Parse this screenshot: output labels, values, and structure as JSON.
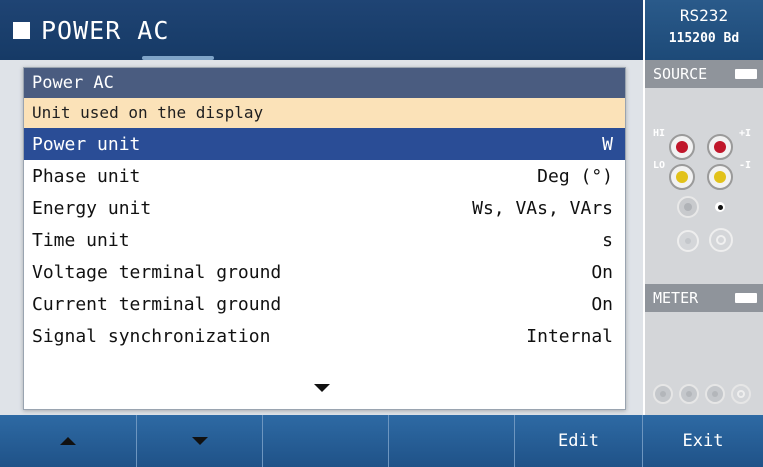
{
  "header": {
    "title": "POWER AC",
    "interface": "RS232",
    "baud": "115200 Bd"
  },
  "dialog": {
    "title": "Power AC",
    "description": "Unit used on the display",
    "rows": [
      {
        "label": "Power unit",
        "value": "W",
        "selected": true
      },
      {
        "label": "Phase unit",
        "value": "Deg (°)"
      },
      {
        "label": "Energy unit",
        "value": "Ws, VAs, VArs"
      },
      {
        "label": "Time unit",
        "value": "s"
      },
      {
        "label": "Voltage terminal ground",
        "value": "On"
      },
      {
        "label": "Current terminal ground",
        "value": "On"
      },
      {
        "label": "Signal synchronization",
        "value": "Internal"
      }
    ],
    "more_indicator": "chevron-down-icon"
  },
  "side_panel": {
    "source_label": "SOURCE",
    "meter_label": "METER",
    "terminals": {
      "hi": "HI",
      "lo": "LO",
      "plus_i": "+I",
      "minus_i": "-I"
    }
  },
  "softkeys": [
    {
      "id": "up",
      "label": "",
      "icon": "up-arrow-icon"
    },
    {
      "id": "down",
      "label": "",
      "icon": "down-arrow-icon"
    },
    {
      "id": "empty1",
      "label": ""
    },
    {
      "id": "empty2",
      "label": ""
    },
    {
      "id": "edit",
      "label": "Edit"
    },
    {
      "id": "exit",
      "label": "Exit"
    }
  ],
  "colors": {
    "header_bg": "#1f4474",
    "selected_row": "#2a4d96",
    "dialog_title": "#4a5c80",
    "description_bg": "#fbe2b8",
    "softkey_bg": "#2e6aa4",
    "jack_red": "#c0162a",
    "jack_yellow": "#e2c21a"
  }
}
